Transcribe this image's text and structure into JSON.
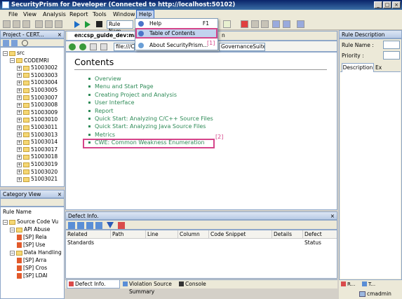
{
  "window": {
    "title": "SecurityPrism for Developer (Connected to http://localhost:50102)",
    "min": "_",
    "max": "□",
    "close": "×"
  },
  "menu": {
    "items": [
      "File",
      "View",
      "Analysis",
      "Report",
      "Tools",
      "Window",
      "Help"
    ],
    "active": "Help"
  },
  "toolbar": {
    "rule_name_label": "Rule Nam"
  },
  "help_menu": {
    "items": [
      {
        "label": "Help",
        "shortcut": "F1"
      },
      {
        "label": "Table of Contents",
        "shortcut": ""
      },
      {
        "label": "About SecurityPrism...",
        "shortcut": ""
      }
    ],
    "annotation": "[1]"
  },
  "project_panel": {
    "title": "Project - CERT...",
    "tree": [
      {
        "label": "src",
        "depth": 0,
        "expanded": true
      },
      {
        "label": "CODEMRI",
        "depth": 1,
        "expanded": true
      },
      {
        "label": "51003002",
        "depth": 2
      },
      {
        "label": "51003003",
        "depth": 2
      },
      {
        "label": "51003004",
        "depth": 2
      },
      {
        "label": "51003005",
        "depth": 2
      },
      {
        "label": "51003007",
        "depth": 2
      },
      {
        "label": "51003008",
        "depth": 2
      },
      {
        "label": "51003009",
        "depth": 2
      },
      {
        "label": "51003010",
        "depth": 2
      },
      {
        "label": "51003011",
        "depth": 2
      },
      {
        "label": "51003013",
        "depth": 2
      },
      {
        "label": "51003014",
        "depth": 2
      },
      {
        "label": "51003017",
        "depth": 2
      },
      {
        "label": "51003018",
        "depth": 2
      },
      {
        "label": "51003019",
        "depth": 2
      },
      {
        "label": "51003020",
        "depth": 2
      },
      {
        "label": "51003021",
        "depth": 2
      }
    ]
  },
  "category_panel": {
    "title": "Category View",
    "column": "Rule Name",
    "tree": [
      {
        "label": "Source Code Vu",
        "depth": 0,
        "type": "folder"
      },
      {
        "label": "API Abuse",
        "depth": 1,
        "type": "folder"
      },
      {
        "label": "[SP] Rela",
        "depth": 2,
        "type": "rule"
      },
      {
        "label": "[SP] Use",
        "depth": 2,
        "type": "rule"
      },
      {
        "label": "Data Handling",
        "depth": 1,
        "type": "folder"
      },
      {
        "label": "[SP] Arra",
        "depth": 2,
        "type": "rule"
      },
      {
        "label": "[SP] Cros",
        "depth": 2,
        "type": "rule"
      },
      {
        "label": "[SP] LDAI",
        "depth": 2,
        "type": "rule"
      }
    ]
  },
  "editor": {
    "tab_label": "en:csp_guide_dev:ma",
    "tab_label_right": "n",
    "address": "file:///C",
    "address_right": "GovernanceSuite",
    "heading": "Contents",
    "links": [
      "Overview",
      "Menu and Start Page",
      "Creating Project and Analysis",
      "User Interface",
      "Report",
      "Quick Start: Analyzing C/C++ Source Files",
      "Quick Start: Analyzing Java Source Files",
      "Metrics",
      "CWE: Common Weakness Enumeration"
    ],
    "annotation": "[2]"
  },
  "defect_panel": {
    "title": "Defect Info.",
    "columns": [
      "Related Standards",
      "Path",
      "Line",
      "Column",
      "Code Snippet",
      "Details",
      "Defect Status"
    ]
  },
  "bottom_tabs": [
    "Defect Info.",
    "Violation Source Summary",
    "Console"
  ],
  "rule_panel": {
    "title": "Rule Description",
    "rule_name_label": "Rule Name :",
    "priority_label": "Priority :",
    "tabs": [
      "Description",
      "Ex"
    ]
  },
  "status": {
    "user": "cmadmin",
    "mini_tabs": [
      "R...",
      "T..."
    ]
  }
}
